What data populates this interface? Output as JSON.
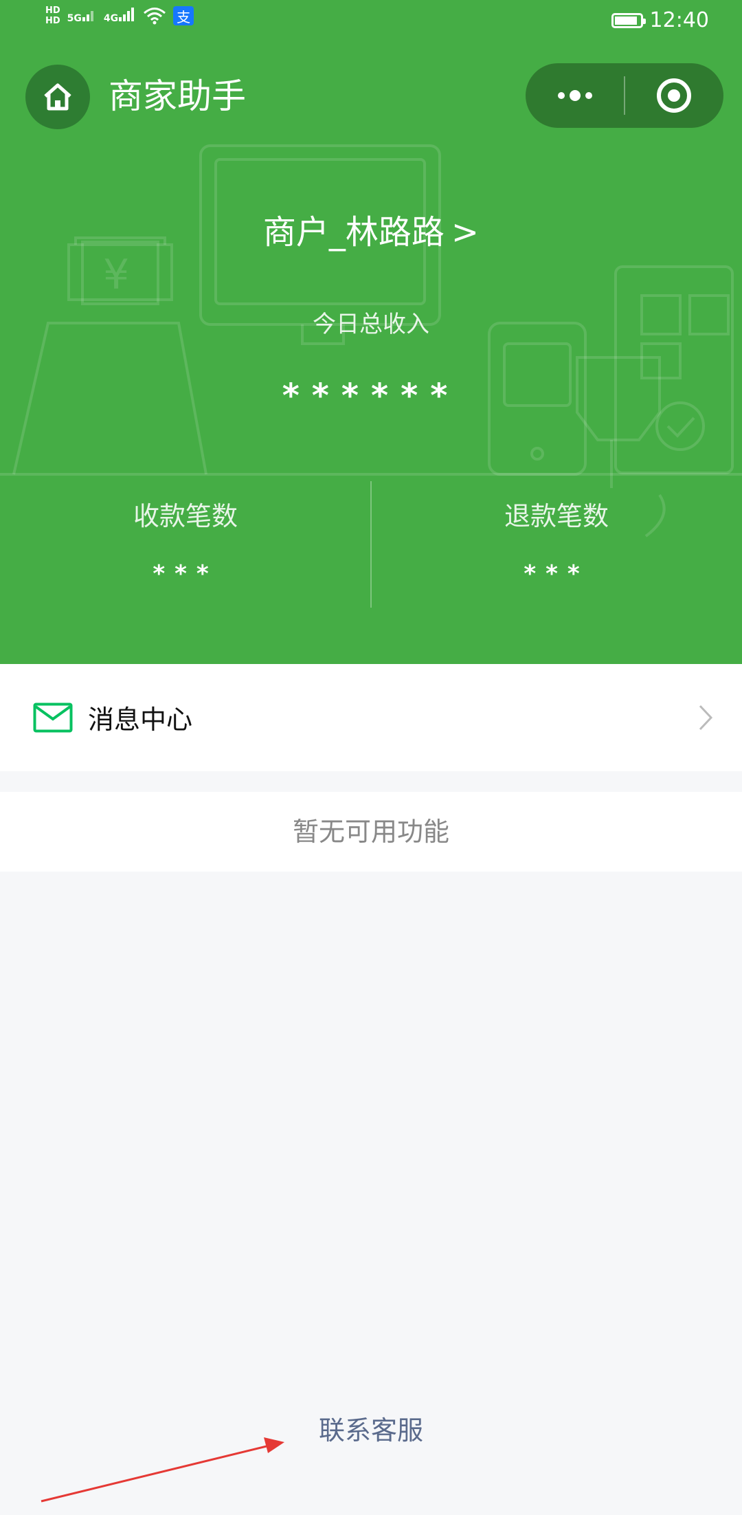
{
  "status_bar": {
    "hd1": "HD",
    "hd2": "HD",
    "signal1": "5G",
    "signal2": "4G",
    "alipay_glyph": "支",
    "time": "12:40",
    "battery_level": 0.9
  },
  "nav": {
    "title": "商家助手",
    "home_icon": "home-icon",
    "more_icon": "more-dots-icon",
    "close_icon": "target-icon"
  },
  "header": {
    "merchant_name": "商户_林路路",
    "merchant_chevron": ">",
    "income_label": "今日总收入",
    "income_value": "******",
    "stats": [
      {
        "label": "收款笔数",
        "value": "***"
      },
      {
        "label": "退款笔数",
        "value": "***"
      }
    ]
  },
  "list": {
    "message_center": "消息中心",
    "empty_text": "暂无可用功能"
  },
  "footer": {
    "contact": "联系客服"
  },
  "colors": {
    "primary_green": "#45ad45",
    "dark_green": "#2f7a2f",
    "icon_green": "#07c160",
    "arrow_red": "#e53935"
  }
}
